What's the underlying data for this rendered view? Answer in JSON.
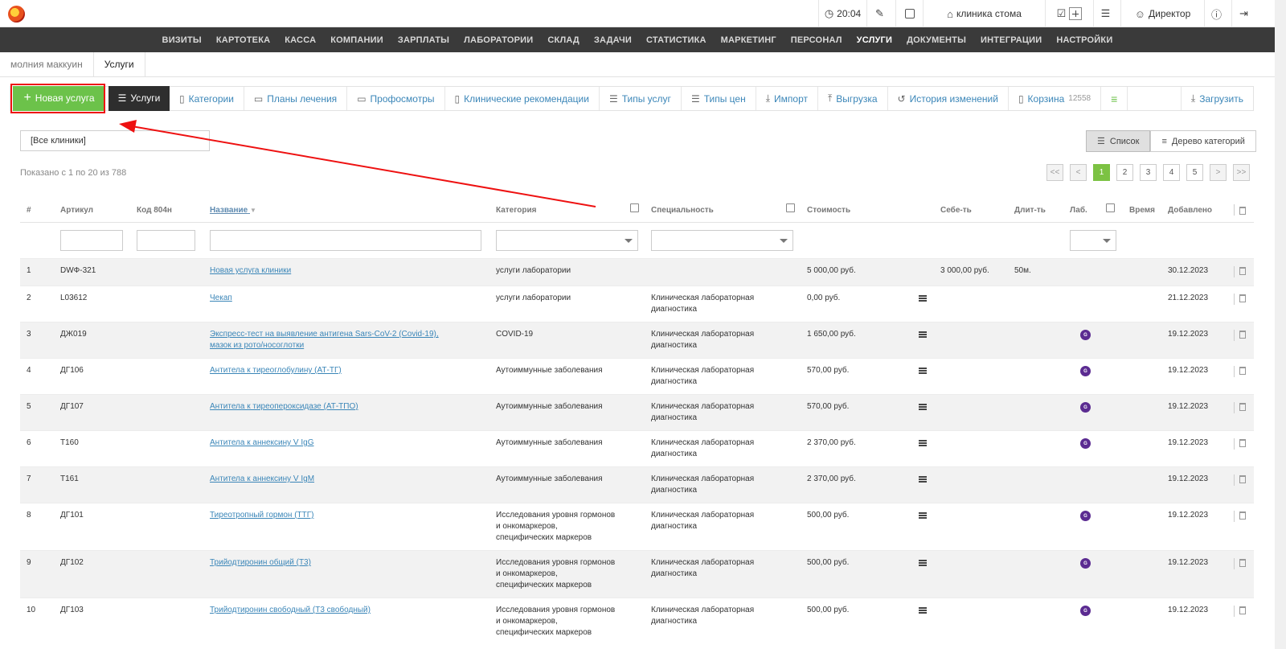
{
  "topbar": {
    "time": "20:04",
    "clinic": "клиника стома",
    "user": "Директор"
  },
  "menu": [
    "ВИЗИТЫ",
    "КАРТОТЕКА",
    "КАССА",
    "КОМПАНИИ",
    "ЗАРПЛАТЫ",
    "ЛАБОРАТОРИИ",
    "СКЛАД",
    "ЗАДАЧИ",
    "СТАТИСТИКА",
    "МАРКЕТИНГ",
    "ПЕРСОНАЛ",
    "УСЛУГИ",
    "ДОКУМЕНТЫ",
    "ИНТЕГРАЦИИ",
    "НАСТРОЙКИ"
  ],
  "menu_active": "УСЛУГИ",
  "breadcrumb": {
    "parent": "молния маккуин",
    "current": "Услуги"
  },
  "toolbar": {
    "new_service": "Новая услуга",
    "services": "Услуги",
    "links": [
      "Категории",
      "Планы лечения",
      "Профосмотры",
      "Клинические рекомендации",
      "Типы услуг",
      "Типы цен",
      "Импорт",
      "Выгрузка",
      "История изменений"
    ],
    "basket": "Корзина",
    "basket_count": "12558",
    "download": "Загрузить"
  },
  "filter": {
    "clinic_select": "[Все клиники]"
  },
  "view": {
    "list": "Список",
    "tree": "Дерево категорий"
  },
  "shown_text": "Показано с 1 по 20 из 788",
  "pager": [
    "<<",
    "<",
    "1",
    "2",
    "3",
    "4",
    "5",
    ">",
    ">>"
  ],
  "pager_active": "1",
  "table": {
    "headers": {
      "num": "#",
      "article": "Артикул",
      "code": "Код 804н",
      "name": "Название",
      "category": "Категория",
      "specialty": "Специальность",
      "cost": "Стоимость",
      "selfcost": "Себе-ть",
      "duration": "Длит-ть",
      "lab": "Лаб.",
      "time": "Время",
      "added": "Добавлено"
    },
    "rows": [
      {
        "num": "1",
        "article": "DWФ-321",
        "name": [
          "Новая услуга клиники"
        ],
        "category": [
          "услуги лаборатории"
        ],
        "specialty": [],
        "cost": "5 000,00 руб.",
        "list": false,
        "selfcost": "3 000,00 руб.",
        "duration": "50м.",
        "lab": false,
        "added": "30.12.2023"
      },
      {
        "num": "2",
        "article": "L03612",
        "name": [
          "Чекап"
        ],
        "category": [
          "услуги лаборатории"
        ],
        "specialty": [
          "Клиническая лабораторная",
          "диагностика"
        ],
        "cost": "0,00 руб.",
        "list": true,
        "selfcost": "",
        "duration": "",
        "lab": false,
        "added": "21.12.2023"
      },
      {
        "num": "3",
        "article": "ДЖ019",
        "name": [
          "Экспресс-тест на выявление антигена Sars-CoV-2 (Covid-19),",
          "мазок из рото/носоглотки"
        ],
        "category": [
          "COVID-19"
        ],
        "specialty": [
          "Клиническая лабораторная",
          "диагностика"
        ],
        "cost": "1 650,00 руб.",
        "list": true,
        "selfcost": "",
        "duration": "",
        "lab": true,
        "added": "19.12.2023"
      },
      {
        "num": "4",
        "article": "ДГ106",
        "name": [
          "Антитела к тиреоглобулину (АТ-ТГ)"
        ],
        "category": [
          "Аутоиммунные заболевания"
        ],
        "specialty": [
          "Клиническая лабораторная",
          "диагностика"
        ],
        "cost": "570,00 руб.",
        "list": true,
        "selfcost": "",
        "duration": "",
        "lab": true,
        "added": "19.12.2023"
      },
      {
        "num": "5",
        "article": "ДГ107",
        "name": [
          "Антитела к тиреопероксидазе (АТ-ТПО)"
        ],
        "category": [
          "Аутоиммунные заболевания"
        ],
        "specialty": [
          "Клиническая лабораторная",
          "диагностика"
        ],
        "cost": "570,00 руб.",
        "list": true,
        "selfcost": "",
        "duration": "",
        "lab": true,
        "added": "19.12.2023"
      },
      {
        "num": "6",
        "article": "T160",
        "name": [
          "Антитела к аннексину V IgG"
        ],
        "category": [
          "Аутоиммунные заболевания"
        ],
        "specialty": [
          "Клиническая лабораторная",
          "диагностика"
        ],
        "cost": "2 370,00 руб.",
        "list": true,
        "selfcost": "",
        "duration": "",
        "lab": true,
        "added": "19.12.2023"
      },
      {
        "num": "7",
        "article": "T161",
        "name": [
          "Антитела к аннексину V IgM"
        ],
        "category": [
          "Аутоиммунные заболевания"
        ],
        "specialty": [
          "Клиническая лабораторная",
          "диагностика"
        ],
        "cost": "2 370,00 руб.",
        "list": true,
        "selfcost": "",
        "duration": "",
        "lab": false,
        "added": "19.12.2023"
      },
      {
        "num": "8",
        "article": "ДГ101",
        "name": [
          "Тиреотропный гормон (ТТГ)"
        ],
        "category": [
          "Исследования уровня гормонов",
          "и онкомаркеров,",
          "специфических маркеров"
        ],
        "specialty": [
          "Клиническая лабораторная",
          "диагностика"
        ],
        "cost": "500,00 руб.",
        "list": true,
        "selfcost": "",
        "duration": "",
        "lab": true,
        "added": "19.12.2023"
      },
      {
        "num": "9",
        "article": "ДГ102",
        "name": [
          "Трийодтиронин общий (Т3)"
        ],
        "category": [
          "Исследования уровня гормонов",
          "и онкомаркеров,",
          "специфических маркеров"
        ],
        "specialty": [
          "Клиническая лабораторная",
          "диагностика"
        ],
        "cost": "500,00 руб.",
        "list": true,
        "selfcost": "",
        "duration": "",
        "lab": true,
        "added": "19.12.2023"
      },
      {
        "num": "10",
        "article": "ДГ103",
        "name": [
          "Трийодтиронин свободный (Т3 свободный)"
        ],
        "category": [
          "Исследования уровня гормонов",
          "и онкомаркеров,",
          "специфических маркеров"
        ],
        "specialty": [
          "Клиническая лабораторная",
          "диагностика"
        ],
        "cost": "500,00 руб.",
        "list": true,
        "selfcost": "",
        "duration": "",
        "lab": true,
        "added": "19.12.2023"
      }
    ]
  },
  "colors": {
    "accent_green": "#6cc24a",
    "menu_bg": "#3a3a3a",
    "link": "#3b86b8",
    "lab_badge": "#5b2b91",
    "annotation": "#ee1111"
  }
}
